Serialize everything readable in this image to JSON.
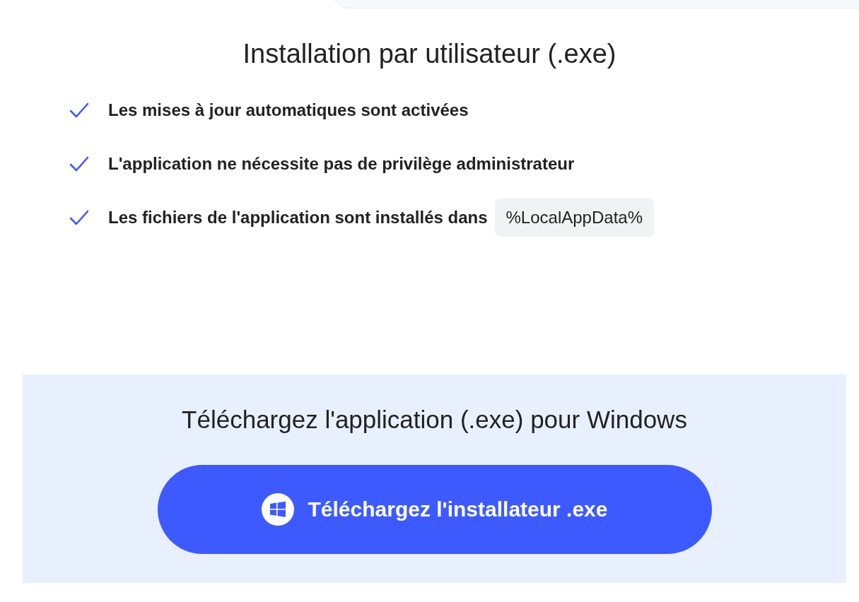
{
  "title": "Installation par utilisateur (.exe)",
  "features": [
    {
      "text": "Les mises à jour automatiques sont activées"
    },
    {
      "text": "L'application ne nécessite pas de privilège administrateur"
    },
    {
      "text": "Les fichiers de l'application sont installés dans",
      "code": "%LocalAppData%"
    }
  ],
  "download": {
    "heading": "Téléchargez l'application (.exe) pour Windows",
    "button": "Téléchargez l'installateur .exe"
  }
}
